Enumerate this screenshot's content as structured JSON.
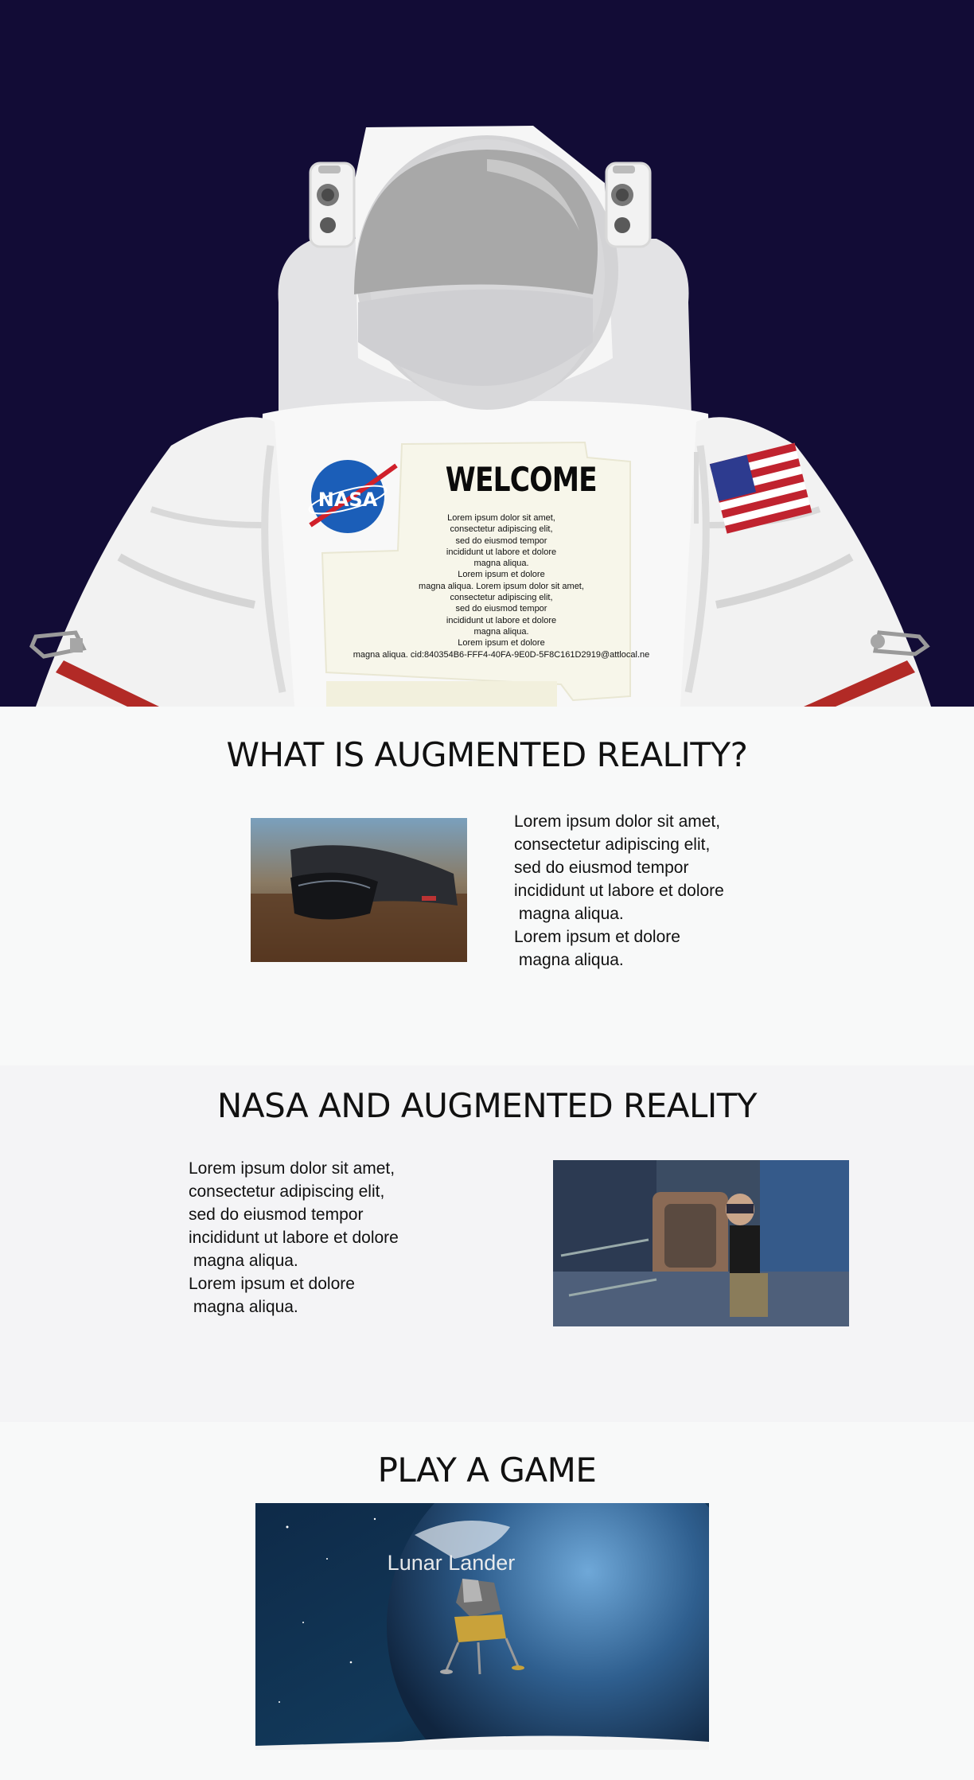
{
  "hero": {
    "welcome_title": "WELCOME",
    "welcome_lines": [
      "Lorem ipsum dolor sit amet,",
      "consectetur adipiscing elit,",
      "sed do eiusmod tempor",
      "incididunt ut labore et dolore",
      "magna aliqua.",
      "Lorem ipsum et dolore",
      "magna aliqua. Lorem ipsum dolor sit amet,",
      "consectetur adipiscing elit,",
      "sed do eiusmod tempor",
      "incididunt ut labore et dolore",
      "magna aliqua.",
      "Lorem ipsum et dolore",
      "magna aliqua. cid:840354B6-FFF4-40FA-9E0D-5F8C161D2919@attlocal.ne"
    ],
    "nasa_logo_text": "NASA"
  },
  "section_ar": {
    "title": "WHAT IS AUGMENTED REALITY?",
    "lines": [
      "Lorem ipsum dolor sit amet,",
      "consectetur adipiscing elit,",
      "sed do eiusmod tempor",
      "incididunt ut labore et dolore",
      " magna aliqua.",
      "Lorem ipsum et dolore",
      " magna aliqua."
    ]
  },
  "section_nasa": {
    "title": "NASA AND AUGMENTED REALITY",
    "lines": [
      "Lorem ipsum dolor sit amet,",
      "consectetur adipiscing elit,",
      "sed do eiusmod tempor",
      "incididunt ut labore et dolore",
      " magna aliqua.",
      "Lorem ipsum et dolore",
      " magna aliqua."
    ]
  },
  "section_game": {
    "title": "PLAY A GAME",
    "game_label": "Lunar Lander"
  },
  "colors": {
    "hero_bg": "#120c36",
    "suit": "#f7f7f7",
    "visor": "#bfbfbf",
    "flag_red": "#c0232f",
    "flag_blue": "#2d3b8f",
    "strap_red": "#b22a26",
    "nameplate": "#f7f6ea"
  }
}
